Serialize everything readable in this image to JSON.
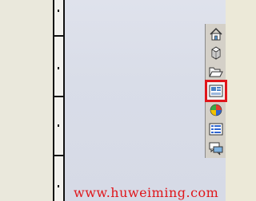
{
  "watermark": {
    "text": "www.huweiming.com",
    "color": "#e0161b"
  },
  "taskpane": {
    "buttons": [
      {
        "icon": "home-icon",
        "active": false
      },
      {
        "icon": "design-library-icon",
        "active": false
      },
      {
        "icon": "file-explorer-icon",
        "active": false
      },
      {
        "icon": "view-palette-icon",
        "active": true
      },
      {
        "icon": "appearances-icon",
        "active": false
      },
      {
        "icon": "custom-properties-icon",
        "active": false
      },
      {
        "icon": "forum-icon",
        "active": false
      }
    ],
    "highlight_color": "#e0161b"
  }
}
